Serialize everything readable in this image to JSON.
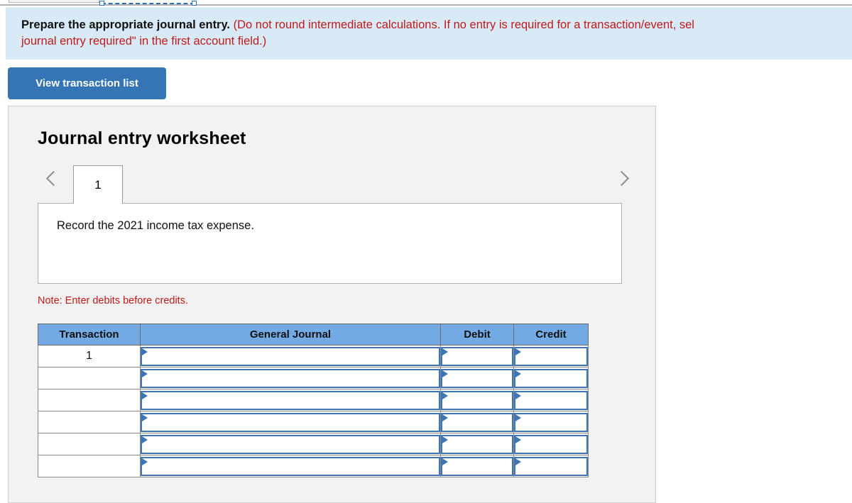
{
  "banner": {
    "bold_text": "Prepare the appropriate journal entry.",
    "red_text_line1": "(Do not round intermediate calculations. If no entry is required for a transaction/event, sel",
    "red_text_line2": "journal entry required\" in the first account field.)"
  },
  "buttons": {
    "view_transaction_list": "View transaction list"
  },
  "worksheet": {
    "title": "Journal entry worksheet",
    "prev_icon": "chevron-left-icon",
    "next_icon": "chevron-right-icon",
    "tabs": [
      {
        "label": "1"
      }
    ],
    "description": "Record the 2021 income tax expense.",
    "note": "Note: Enter debits before credits."
  },
  "journal_table": {
    "headers": [
      "Transaction",
      "General Journal",
      "Debit",
      "Credit"
    ],
    "rows": [
      {
        "transaction": "1",
        "general_journal": "",
        "debit": "",
        "credit": ""
      },
      {
        "transaction": "",
        "general_journal": "",
        "debit": "",
        "credit": ""
      },
      {
        "transaction": "",
        "general_journal": "",
        "debit": "",
        "credit": ""
      },
      {
        "transaction": "",
        "general_journal": "",
        "debit": "",
        "credit": ""
      },
      {
        "transaction": "",
        "general_journal": "",
        "debit": "",
        "credit": ""
      },
      {
        "transaction": "",
        "general_journal": "",
        "debit": "",
        "credit": ""
      }
    ]
  },
  "colors": {
    "banner_background": "#d9eaf7",
    "button_blue": "#3574b5",
    "table_header_blue": "#74aae4",
    "input_border_blue": "#3e76b5",
    "alert_red": "#c01a1a",
    "panel_background": "#f2f2f2"
  }
}
